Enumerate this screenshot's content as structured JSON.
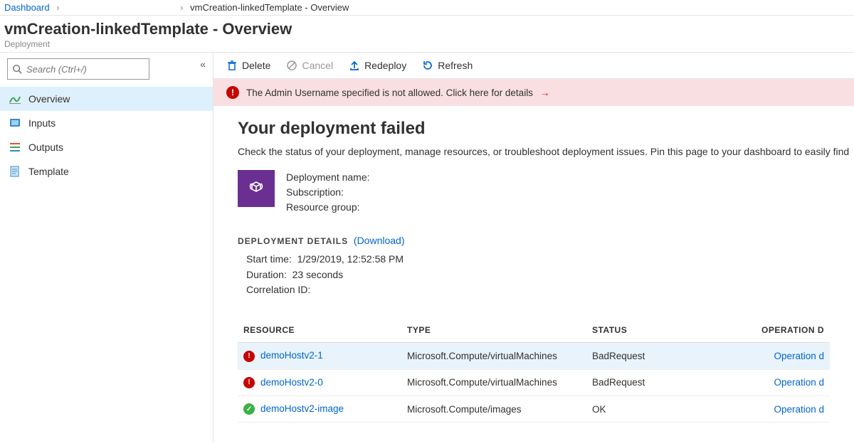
{
  "breadcrumb": {
    "root": "Dashboard",
    "current": "vmCreation-linkedTemplate - Overview"
  },
  "title": "vmCreation-linkedTemplate - Overview",
  "subtitle": "Deployment",
  "search": {
    "placeholder": "Search (Ctrl+/)"
  },
  "nav": {
    "overview": "Overview",
    "inputs": "Inputs",
    "outputs": "Outputs",
    "template": "Template"
  },
  "toolbar": {
    "delete": "Delete",
    "cancel": "Cancel",
    "redeploy": "Redeploy",
    "refresh": "Refresh"
  },
  "alert": {
    "text": "The Admin Username specified is not allowed. Click here for details"
  },
  "overviewPage": {
    "heading": "Your deployment failed",
    "description": "Check the status of your deployment, manage resources, or troubleshoot deployment issues. Pin this page to your dashboard to easily find ",
    "depNameLabel": "Deployment name:",
    "subscriptionLabel": "Subscription:",
    "resourceGroupLabel": "Resource group:",
    "detailsLabel": "DEPLOYMENT DETAILS",
    "downloadLabel": "(Download)",
    "startTimeLabel": "Start time:",
    "startTime": "1/29/2019, 12:52:58 PM",
    "durationLabel": "Duration:",
    "duration": "23 seconds",
    "correlationLabel": "Correlation ID:"
  },
  "table": {
    "headers": {
      "resource": "RESOURCE",
      "type": "TYPE",
      "status": "STATUS",
      "operation": "OPERATION D"
    },
    "rows": [
      {
        "status": "error",
        "resource": "demoHostv2-1",
        "type": "Microsoft.Compute/virtualMachines",
        "statusText": "BadRequest",
        "op": "Operation d"
      },
      {
        "status": "error",
        "resource": "demoHostv2-0",
        "type": "Microsoft.Compute/virtualMachines",
        "statusText": "BadRequest",
        "op": "Operation d"
      },
      {
        "status": "ok",
        "resource": "demoHostv2-image",
        "type": "Microsoft.Compute/images",
        "statusText": "OK",
        "op": "Operation d"
      }
    ]
  }
}
